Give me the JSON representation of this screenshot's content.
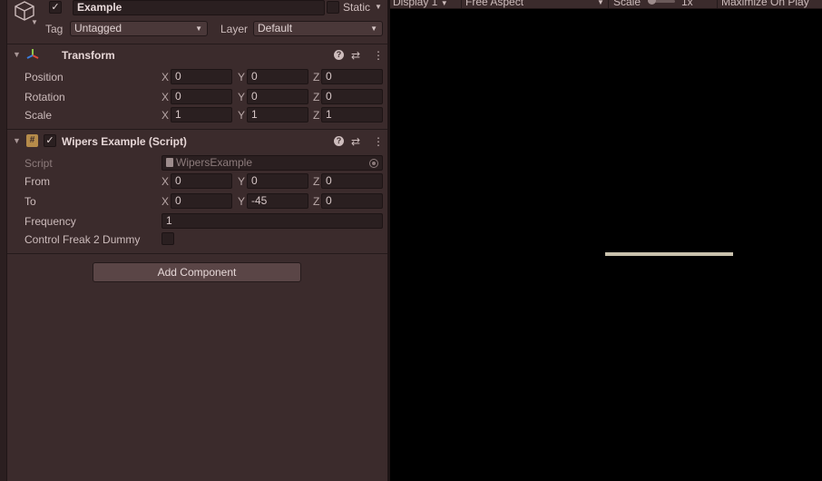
{
  "header": {
    "name": "Example",
    "active_checked": true,
    "static_label": "Static",
    "static_checked": false,
    "tag_label": "Tag",
    "tag_value": "Untagged",
    "layer_label": "Layer",
    "layer_value": "Default"
  },
  "transform": {
    "title": "Transform",
    "rows": [
      {
        "label": "Position",
        "x": "0",
        "y": "0",
        "z": "0"
      },
      {
        "label": "Rotation",
        "x": "0",
        "y": "0",
        "z": "0"
      },
      {
        "label": "Scale",
        "x": "1",
        "y": "1",
        "z": "1"
      }
    ]
  },
  "script_component": {
    "title": "Wipers Example (Script)",
    "enabled": true,
    "script_label": "Script",
    "script_value": "WipersExample",
    "from_label": "From",
    "from": {
      "x": "0",
      "y": "0",
      "z": "0"
    },
    "to_label": "To",
    "to": {
      "x": "0",
      "y": "-45",
      "z": "0"
    },
    "frequency_label": "Frequency",
    "frequency_value": "1",
    "dummy_label": "Control Freak 2 Dummy",
    "dummy_checked": false
  },
  "axes": {
    "x": "X",
    "y": "Y",
    "z": "Z"
  },
  "add_component_label": "Add Component",
  "game_toolbar": {
    "display": "Display 1",
    "aspect": "Free Aspect",
    "scale_label": "Scale",
    "scale_value": "1x",
    "maximize": "Maximize On Play"
  },
  "colors": {
    "panel_bg": "#3b2b2c",
    "game_bg": "#000000",
    "wiper": "#c9c2ad"
  }
}
